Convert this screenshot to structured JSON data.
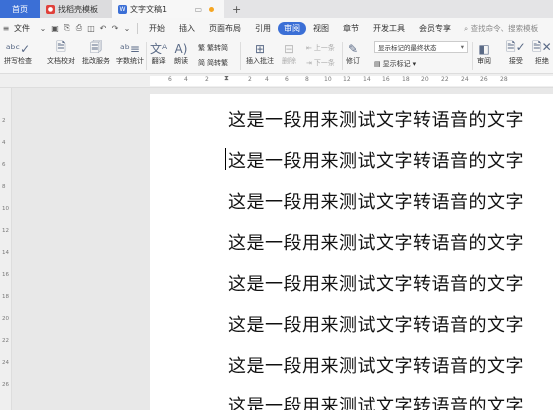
{
  "titlebar": {
    "home": "首页",
    "tab2": "找稻壳模板",
    "tab3": "文字文稿1",
    "plus": "+"
  },
  "menubar": {
    "file": "文件",
    "items": [
      "开始",
      "插入",
      "页面布局",
      "引用",
      "审阅",
      "视图",
      "章节",
      "开发工具",
      "会员专享"
    ],
    "active_index": 4,
    "search": "查找命令、搜索模板"
  },
  "ribbon": {
    "spellcheck": "拼写检查",
    "doccheck": "文档校对",
    "batch": "批改服务",
    "wordcount": "字数统计",
    "translate": "翻译",
    "read": "朗读",
    "trad": "繁转简",
    "simp": "简转繁",
    "insert_comment": "插入批注",
    "delete": "删除",
    "prev": "上一条",
    "next": "下一条",
    "track": "修订",
    "display_state": "显示标记的最终状态",
    "show_markup": "显示标记",
    "review": "审阅",
    "accept": "接受",
    "reject": "拒绝"
  },
  "ruler": {
    "h_numbers": [
      "6",
      "4",
      "2",
      "2",
      "4",
      "6",
      "8",
      "10",
      "12",
      "14",
      "16",
      "18",
      "20",
      "22",
      "24",
      "26",
      "28"
    ],
    "v_numbers": [
      "2",
      "4",
      "6",
      "8",
      "10",
      "12",
      "14",
      "16",
      "18",
      "20",
      "22",
      "24",
      "26"
    ]
  },
  "document": {
    "lines": [
      "这是一段用来测试文字转语音的文字",
      "这是一段用来测试文字转语音的文字",
      "这是一段用来测试文字转语音的文字",
      "这是一段用来测试文字转语音的文字",
      "这是一段用来测试文字转语音的文字",
      "这是一段用来测试文字转语音的文字",
      "这是一段用来测试文字转语音的文字",
      "这是一段用来测试文字转语音的文字"
    ]
  },
  "colors": {
    "accent": "#3b6fd6",
    "tab_icon_red": "#e0403a",
    "tab_icon_blue": "#3b6fd6"
  }
}
